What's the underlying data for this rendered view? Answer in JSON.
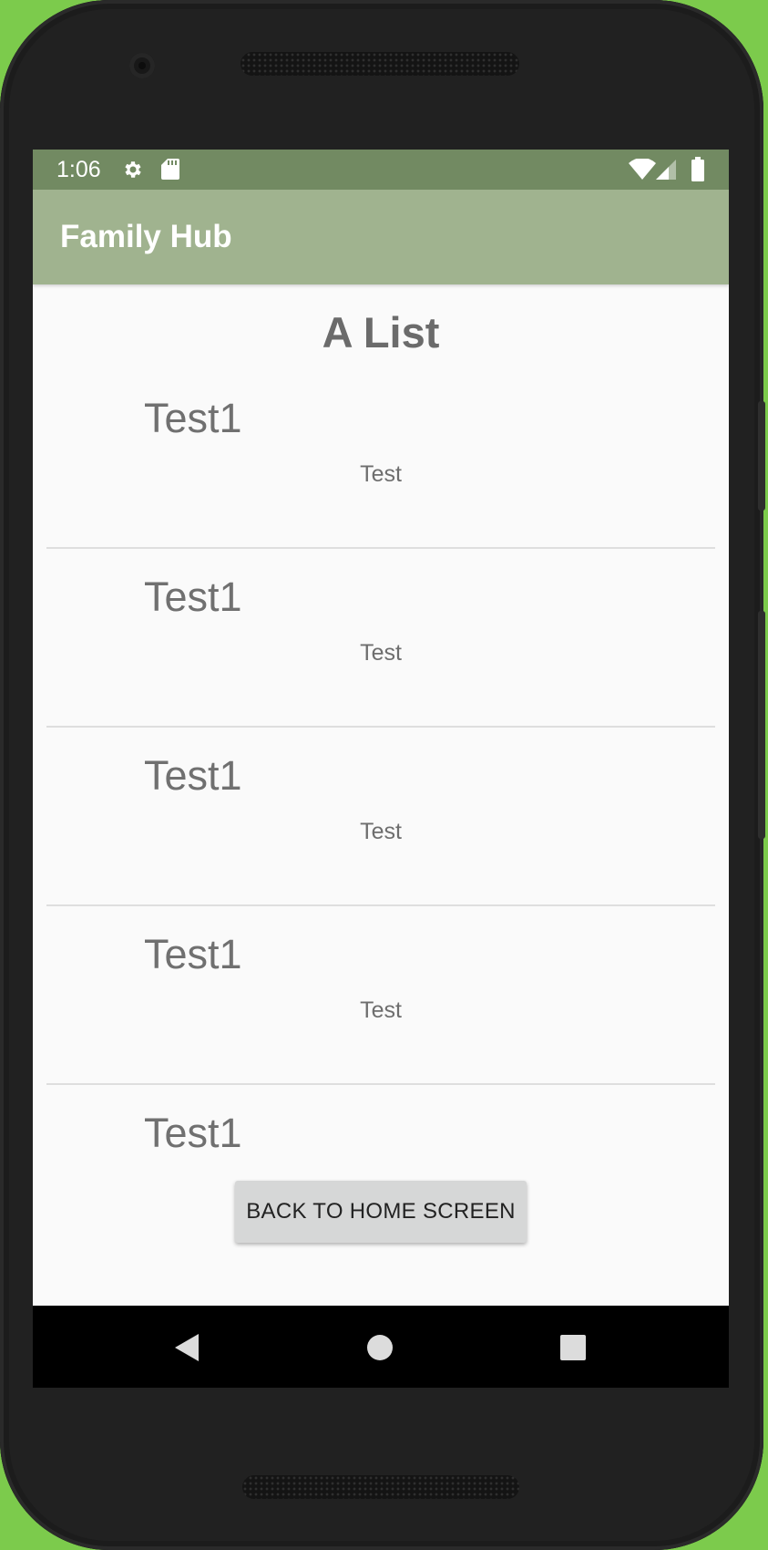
{
  "status_bar": {
    "time": "1:06",
    "icons": [
      "gear-icon",
      "sd-card-icon",
      "wifi-icon",
      "cell-signal-icon",
      "battery-icon"
    ]
  },
  "app_bar": {
    "title": "Family Hub"
  },
  "list": {
    "heading": "A List",
    "items": [
      {
        "title": "Test1",
        "subtitle": "Test"
      },
      {
        "title": "Test1",
        "subtitle": "Test"
      },
      {
        "title": "Test1",
        "subtitle": "Test"
      },
      {
        "title": "Test1",
        "subtitle": "Test"
      },
      {
        "title": "Test1",
        "subtitle": ""
      }
    ]
  },
  "actions": {
    "back_label": "BACK TO HOME SCREEN"
  },
  "nav_bar": {
    "icons": [
      "back-triangle-icon",
      "home-circle-icon",
      "recents-square-icon"
    ]
  },
  "colors": {
    "background": "#7ccb4c",
    "status_bar": "#728a62",
    "app_bar": "#a0b38f",
    "screen": "#fafafa",
    "button": "#d6d7d7"
  }
}
